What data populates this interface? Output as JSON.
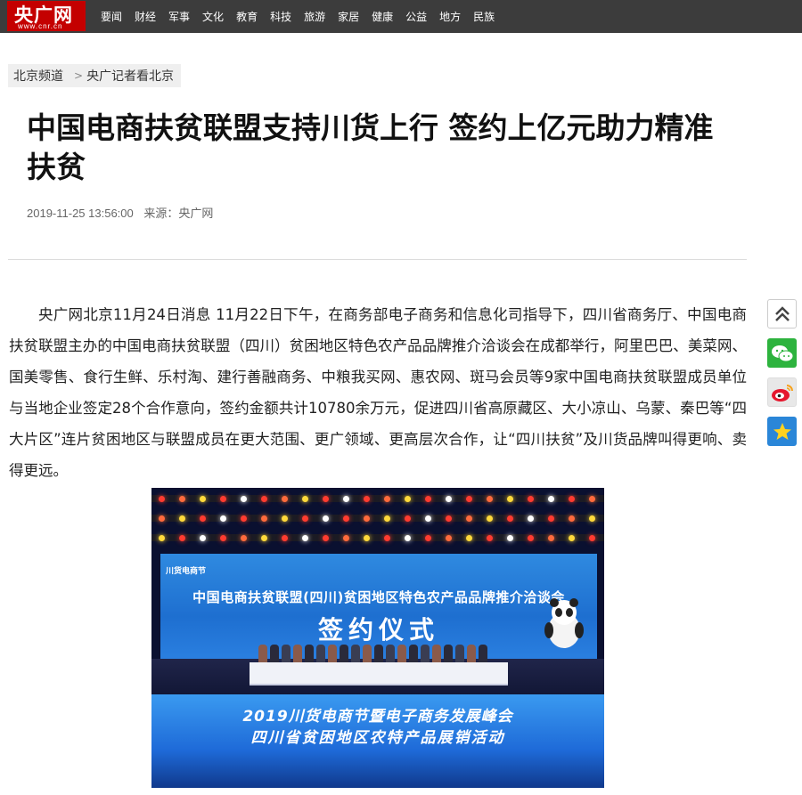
{
  "logo": {
    "main": "央广网",
    "sub": "www.cnr.cn"
  },
  "nav": [
    "要闻",
    "财经",
    "军事",
    "文化",
    "教育",
    "科技",
    "旅游",
    "家居",
    "健康",
    "公益",
    "地方",
    "民族"
  ],
  "breadcrumb": {
    "channel": "北京频道",
    "separator": ">",
    "section": "央广记者看北京"
  },
  "article": {
    "title": "中国电商扶贫联盟支持川货上行 签约上亿元助力精准扶贫",
    "datetime": "2019-11-25 13:56:00",
    "source": "来源：央广网",
    "paragraph": "央广网北京11月24日消息 11月22日下午，在商务部电子商务和信息化司指导下，四川省商务厅、中国电商扶贫联盟主办的中国电商扶贫联盟（四川）贫困地区特色农产品品牌推介洽谈会在成都举行，阿里巴巴、美菜网、国美零售、食行生鲜、乐村淘、建行善融商务、中粮我买网、惠农网、斑马会员等9家中国电商扶贫联盟成员单位与当地企业签定28个合作意向，签约金额共计10780余万元，促进四川省高原藏区、大小凉山、乌蒙、秦巴等“四大片区”连片贫困地区与联盟成员在更大范围、更广领域、更高层次合作，让“四川扶贫”及川货品牌叫得更响、卖得更远。"
  },
  "photo": {
    "banner_logo": "川货电商节",
    "banner_line1": "中国电商扶贫联盟(四川)贫困地区特色农产品品牌推介洽谈会",
    "banner_line2": "签约仪式",
    "led_line1": "2019川货电商节暨电子商务发展峰会",
    "led_line2": "四川省贫困地区农特产品展销活动"
  },
  "share": [
    "back-to-top-icon",
    "wechat-icon",
    "weibo-icon",
    "qzone-icon"
  ]
}
